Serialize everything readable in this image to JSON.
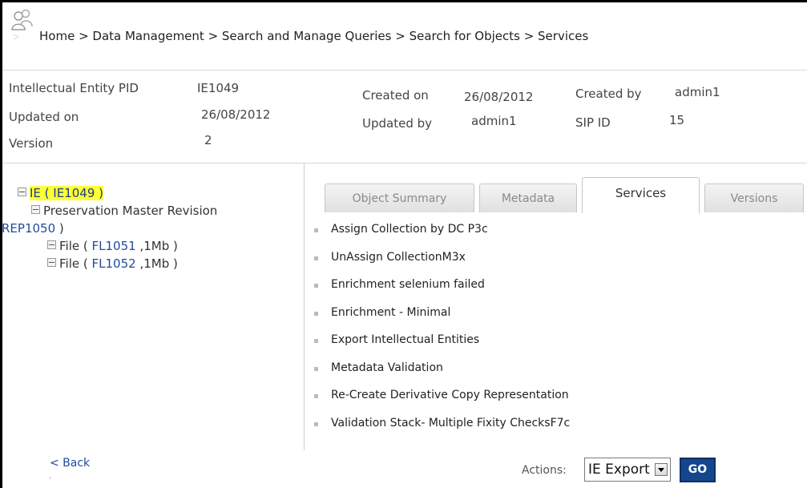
{
  "header": {
    "breadcrumb": "Home > Data Management > Search and Manage Queries > Search for Objects > Services",
    "logo_icon": "users-icon"
  },
  "info": {
    "ie_pid_label": "Intellectual Entity PID",
    "ie_pid": "IE1049",
    "updated_on_label": "Updated on",
    "updated_on": "26/08/2012",
    "version_label": "Version",
    "version": "2",
    "created_on_label": "Created on",
    "created_on": "26/08/2012",
    "updated_by_label": "Updated by",
    "updated_by": "admin1",
    "created_by_label": "Created by",
    "created_by": "admin1",
    "sip_id_label": "SIP ID",
    "sip_id": "15"
  },
  "tree": {
    "root": "IE ( IE1049 )",
    "rep_text": "Preservation Master Revision",
    "rep_link": "REP1050",
    "rep_close": " )",
    "files": [
      {
        "prefix": "File ( ",
        "link": "FL1051",
        "suffix": " ,1Mb )"
      },
      {
        "prefix": "File ( ",
        "link": "FL1052",
        "suffix": " ,1Mb )"
      }
    ]
  },
  "tabs": [
    "Object Summary",
    "Metadata",
    "Services",
    "Versions"
  ],
  "active_tab": "Services",
  "services": [
    "Assign Collection by DC P3c",
    "UnAssign CollectionM3x",
    "Enrichment selenium failed",
    "Enrichment - Minimal",
    "Export Intellectual Entities",
    "Metadata Validation",
    "Re-Create Derivative Copy Representation",
    "Validation Stack- Multiple Fixity ChecksF7c"
  ],
  "footer": {
    "back": "< Back",
    "actions_label": "Actions:",
    "actions_selected": "IE Export",
    "go": "GO"
  },
  "colors": {
    "highlight": "#ffff33",
    "link": "#1e4b9e",
    "go_button": "#14468c"
  }
}
